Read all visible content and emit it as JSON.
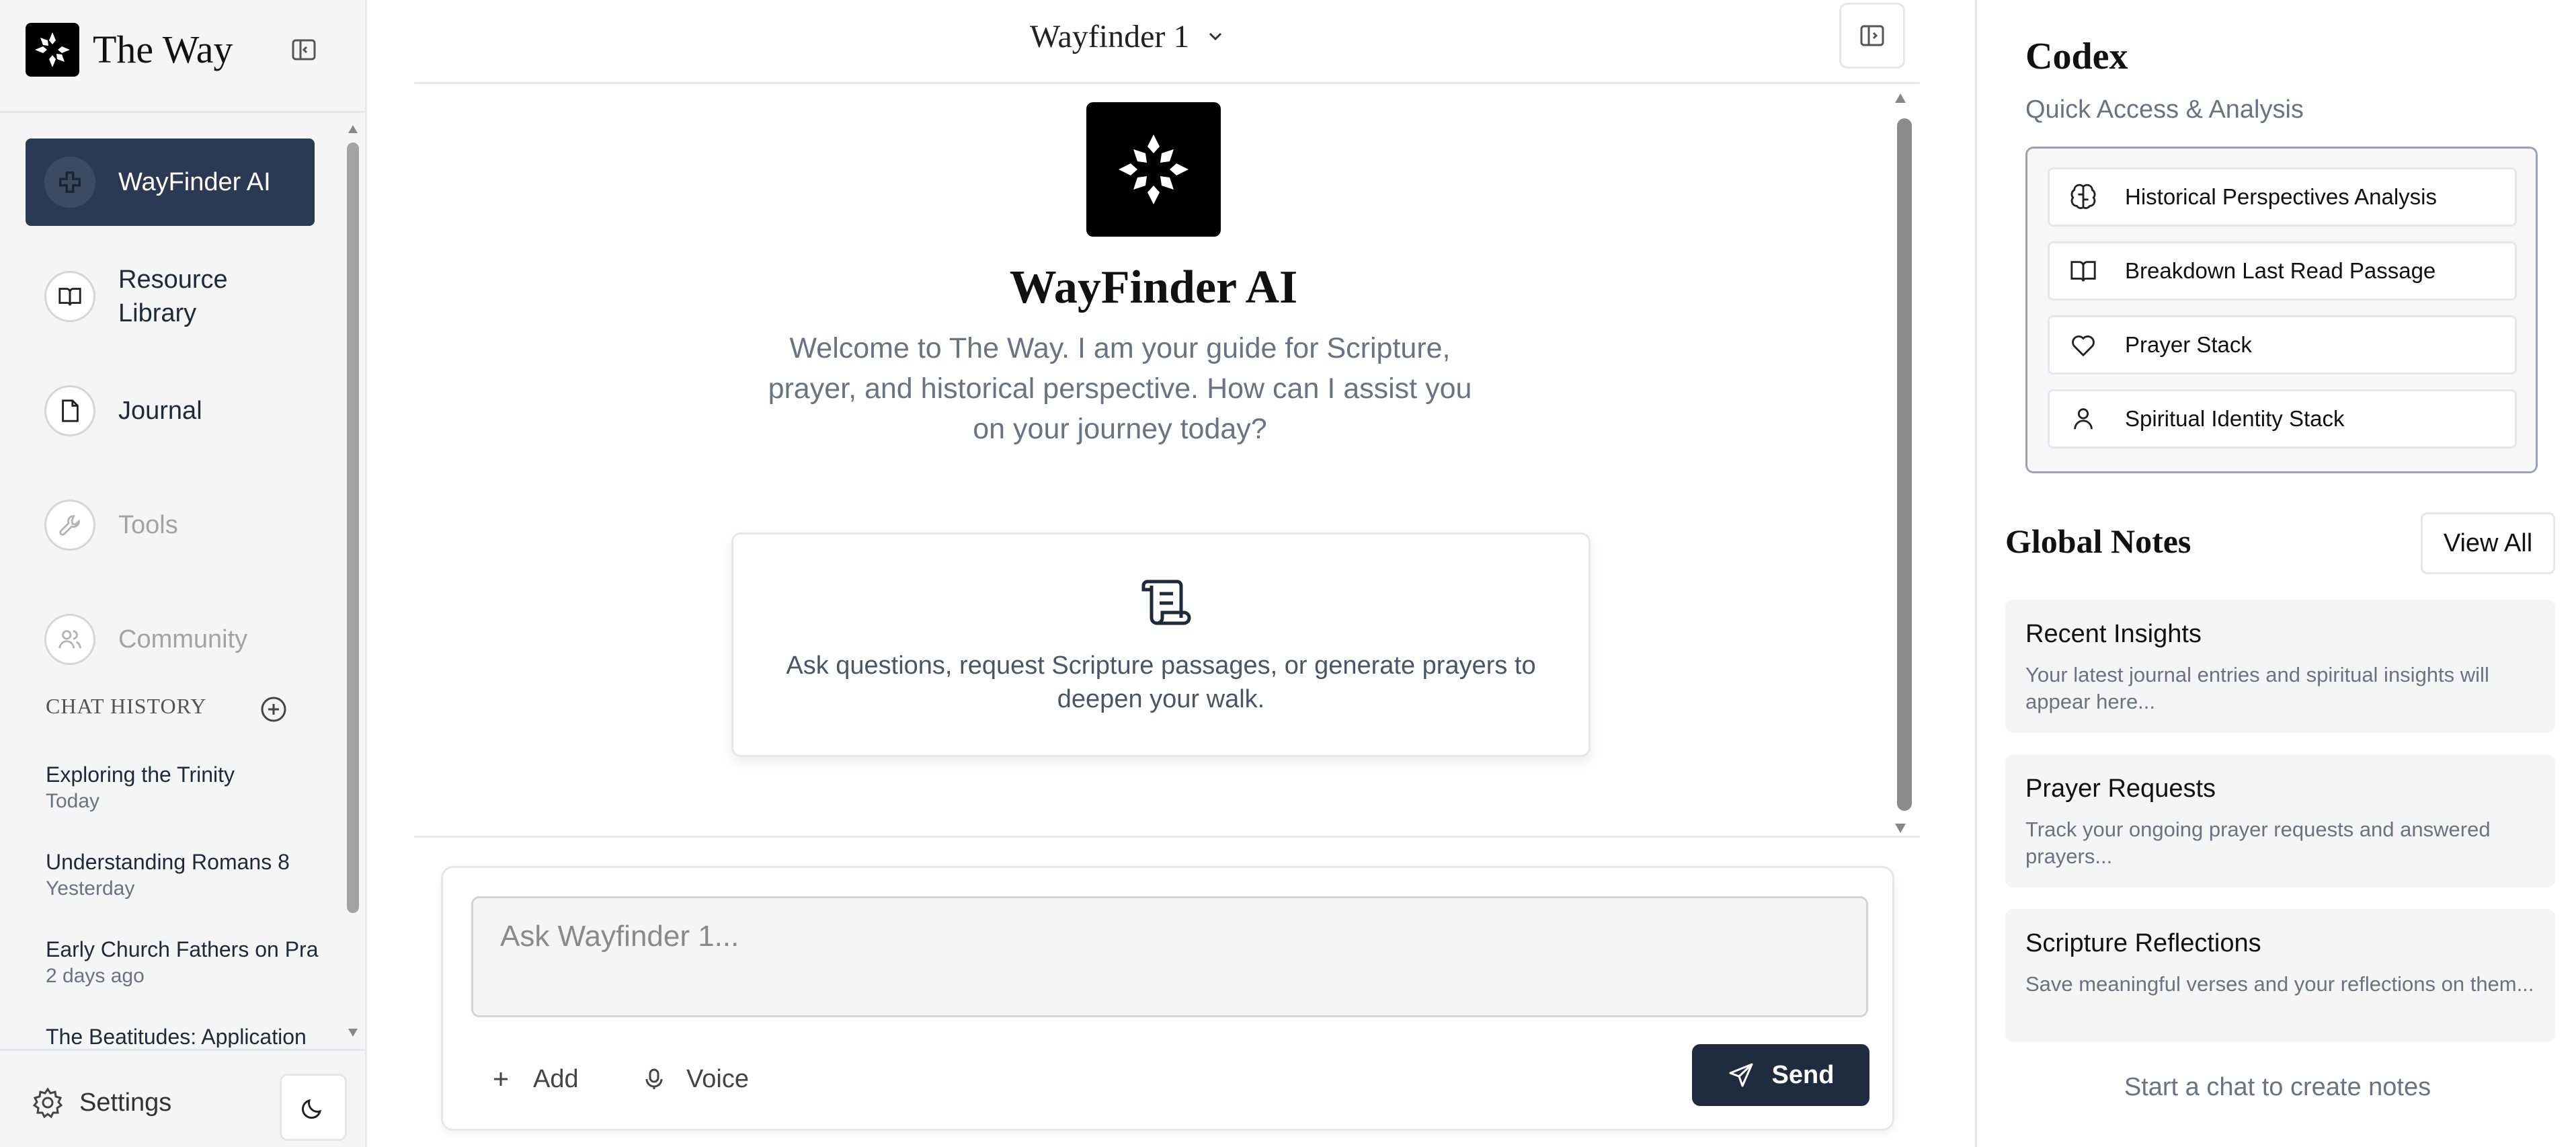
{
  "brand": {
    "name": "The Way"
  },
  "nav": {
    "items": [
      {
        "label": "WayFinder AI",
        "icon": "plus-icon",
        "state": "active"
      },
      {
        "label": "Resource Library",
        "icon": "book-icon",
        "state": "normal"
      },
      {
        "label": "Journal",
        "icon": "file-icon",
        "state": "normal"
      },
      {
        "label": "Tools",
        "icon": "wrench-icon",
        "state": "disabled"
      },
      {
        "label": "Community",
        "icon": "users-icon",
        "state": "disabled"
      }
    ]
  },
  "chat_history": {
    "heading": "CHAT HISTORY",
    "items": [
      {
        "title": "Exploring the Trinity",
        "date": "Today"
      },
      {
        "title": "Understanding Romans 8",
        "date": "Yesterday"
      },
      {
        "title": "Early Church Fathers on Pra",
        "date": "2 days ago"
      },
      {
        "title": "The Beatitudes: Application",
        "date": ""
      }
    ]
  },
  "footer": {
    "settings_label": "Settings",
    "theme_icon": "moon-icon"
  },
  "main": {
    "model_name": "Wayfinder 1",
    "title": "WayFinder AI",
    "welcome": "Welcome to The Way. I am your guide for Scripture, prayer, and historical perspective. How can I assist you on your journey today?",
    "hint": "Ask questions, request Scripture passages, or generate prayers to deepen your walk.",
    "composer": {
      "placeholder": "Ask Wayfinder 1...",
      "add_label": "Add",
      "voice_label": "Voice",
      "send_label": "Send"
    }
  },
  "codex": {
    "title": "Codex",
    "subtitle": "Quick Access & Analysis",
    "items": [
      {
        "label": "Historical Perspectives Analysis",
        "icon": "brain-icon"
      },
      {
        "label": "Breakdown Last Read Passage",
        "icon": "book-open-icon"
      },
      {
        "label": "Prayer Stack",
        "icon": "heart-icon"
      },
      {
        "label": "Spiritual Identity Stack",
        "icon": "user-icon"
      }
    ]
  },
  "notes": {
    "title": "Global Notes",
    "view_all_label": "View All",
    "cards": [
      {
        "title": "Recent Insights",
        "body": "Your latest journal entries and spiritual insights will appear here..."
      },
      {
        "title": "Prayer Requests",
        "body": "Track your ongoing prayer requests and answered prayers..."
      },
      {
        "title": "Scripture Reflections",
        "body": "Save meaningful verses and your reflections on them..."
      }
    ],
    "empty_text": "Start a chat to create notes"
  },
  "colors": {
    "primary_dark": "#1f2b3f",
    "active_nav": "#2a3a52",
    "muted_text": "#6b7280",
    "border": "#e5e7eb"
  }
}
